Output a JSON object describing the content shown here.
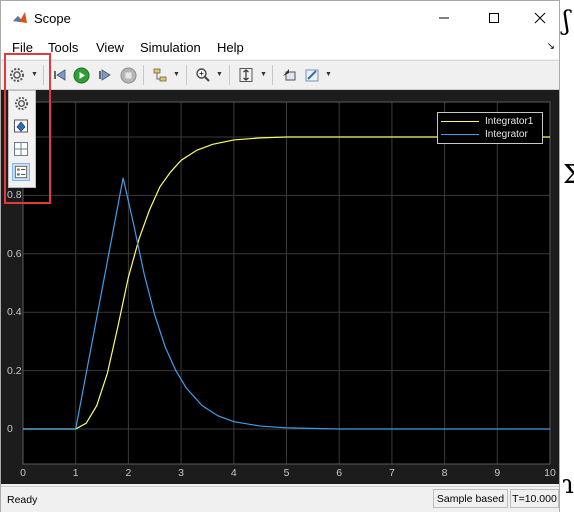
{
  "window": {
    "title": "Scope"
  },
  "menu": {
    "items": [
      "File",
      "Tools",
      "View",
      "Simulation",
      "Help"
    ]
  },
  "toolbar": {
    "icons": [
      "gear-icon",
      "step-back-icon",
      "run-icon",
      "step-forward-icon",
      "stop-icon",
      "signal-selector-icon",
      "zoom-icon",
      "autoscale-icon",
      "highlight-block-icon",
      "edit-icon"
    ]
  },
  "dropdown": {
    "icons": [
      "configuration-properties-icon",
      "style-icon",
      "layout-icon",
      "legend-icon"
    ]
  },
  "plot": {
    "x_ticks": [
      "0",
      "1",
      "2",
      "3",
      "4",
      "5",
      "6",
      "7",
      "8",
      "9",
      "10"
    ],
    "y_ticks": [
      "0",
      "0.2",
      "0.4",
      "0.6",
      "0.8"
    ],
    "legend": [
      {
        "label": "Integrator1",
        "color": "#ffff66"
      },
      {
        "label": "Integrator",
        "color": "#3f9ee8"
      }
    ]
  },
  "chart_data": {
    "type": "line",
    "xlim": [
      0,
      10
    ],
    "ylim": [
      -0.12,
      1.12
    ],
    "grid": true,
    "legend_position": "top-right",
    "series": [
      {
        "name": "Integrator1",
        "color": "#ffff66",
        "x": [
          0,
          1,
          1.2,
          1.4,
          1.6,
          1.8,
          2.0,
          2.2,
          2.4,
          2.6,
          2.8,
          3.0,
          3.3,
          3.6,
          4.0,
          4.5,
          5.0,
          6.0,
          7.0,
          8.0,
          9.0,
          10.0
        ],
        "y": [
          0,
          0,
          0.02,
          0.08,
          0.19,
          0.35,
          0.52,
          0.65,
          0.75,
          0.83,
          0.88,
          0.92,
          0.955,
          0.975,
          0.99,
          0.997,
          1.0,
          1.0,
          1.0,
          1.0,
          1.0,
          1.0
        ]
      },
      {
        "name": "Integrator",
        "color": "#3f9ee8",
        "x": [
          0,
          1,
          1.9,
          2.1,
          2.3,
          2.5,
          2.7,
          2.9,
          3.1,
          3.4,
          3.7,
          4.0,
          4.5,
          5.0,
          6.0,
          7.0,
          8.0,
          9.0,
          10.0
        ],
        "y": [
          0,
          0,
          0.86,
          0.7,
          0.53,
          0.39,
          0.28,
          0.2,
          0.14,
          0.08,
          0.045,
          0.025,
          0.01,
          0.004,
          0,
          0,
          0,
          0,
          0
        ]
      }
    ]
  },
  "status": {
    "left": "Ready",
    "mode": "Sample based",
    "time": "T=10.000"
  }
}
